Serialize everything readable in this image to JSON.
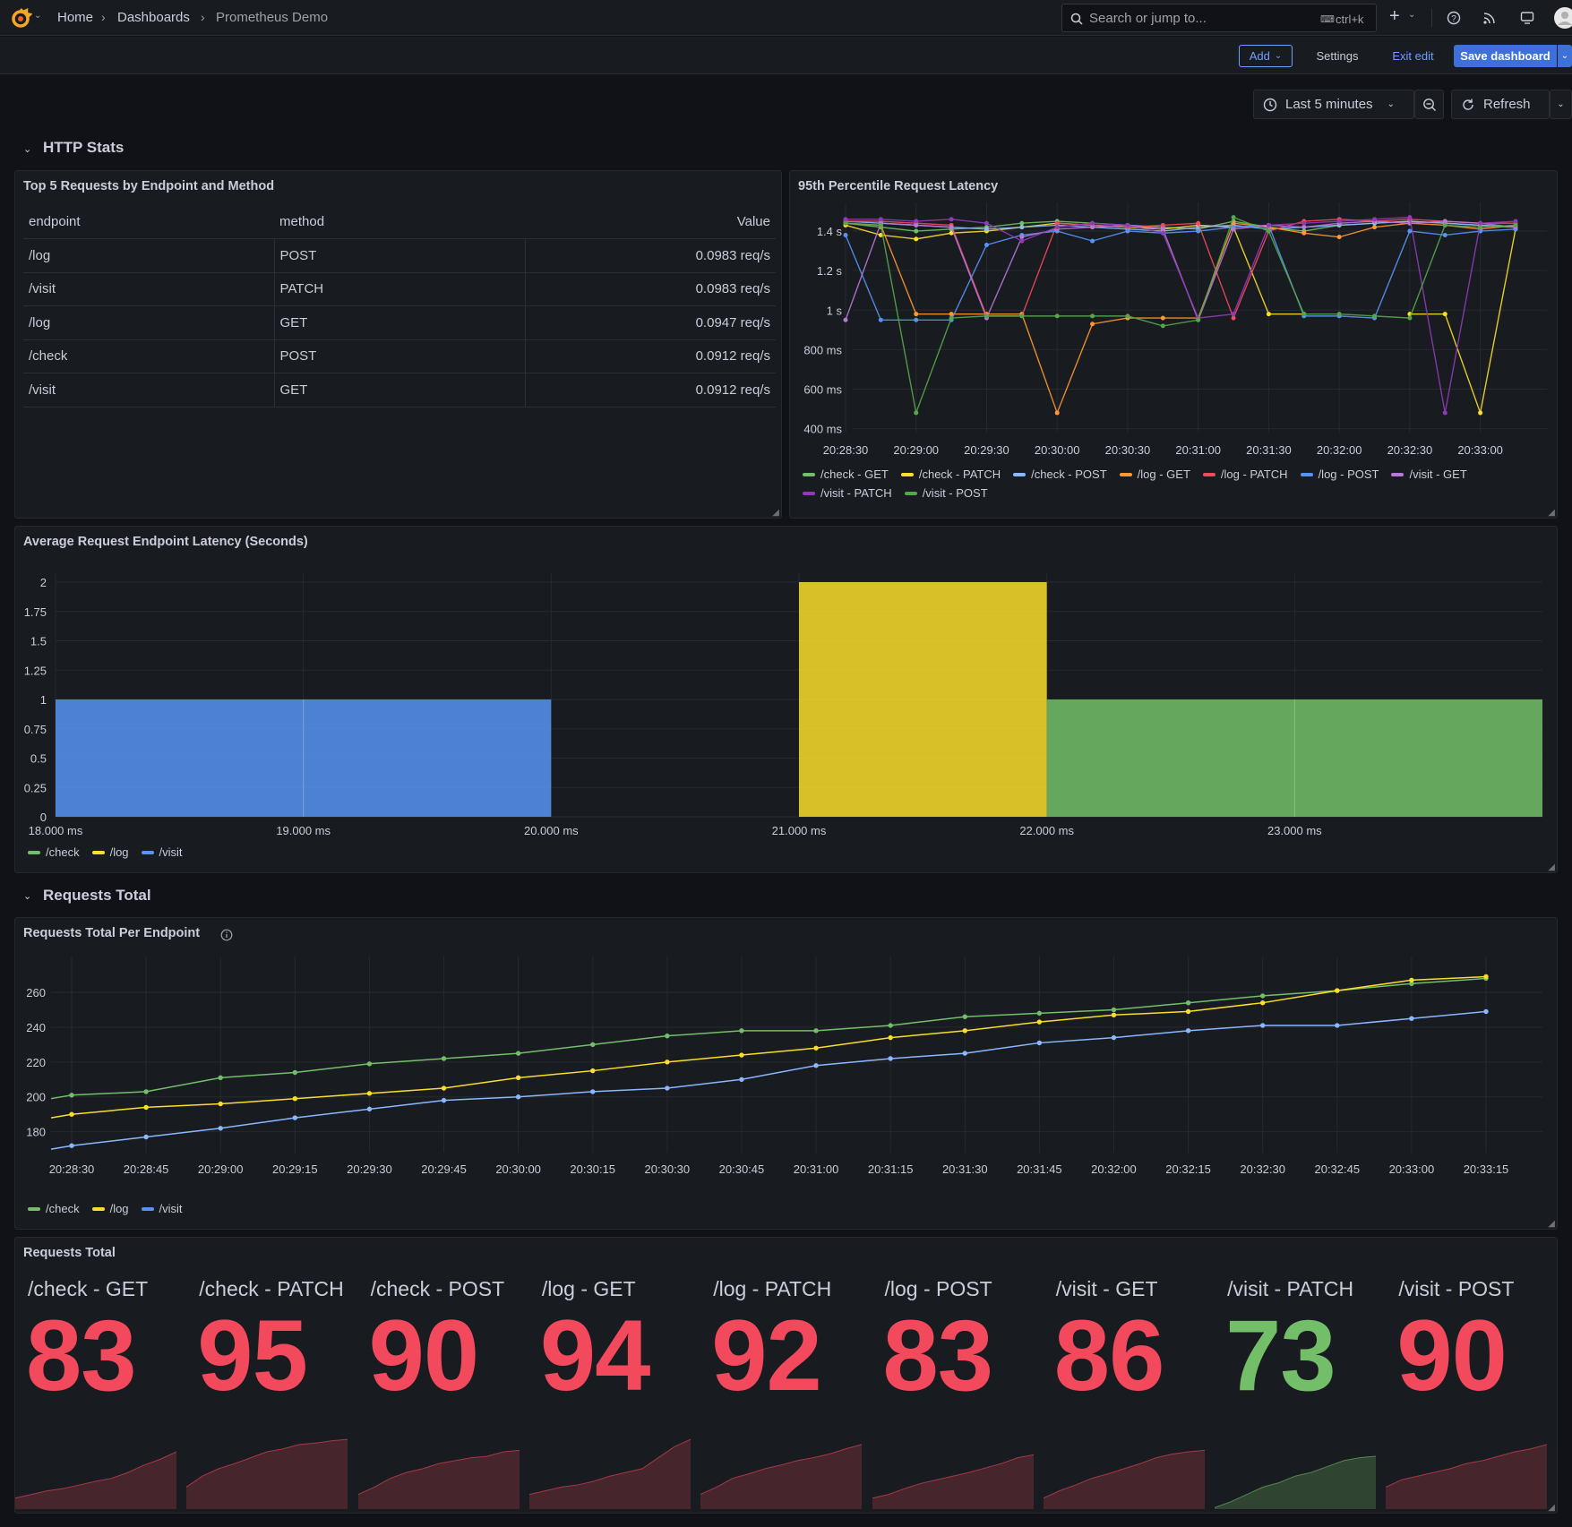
{
  "topbar": {
    "breadcrumbs": [
      "Home",
      "Dashboards",
      "Prometheus Demo"
    ],
    "search_placeholder": "Search or jump to...",
    "search_shortcut": "ctrl+k"
  },
  "toolbar": {
    "add_label": "Add",
    "settings_label": "Settings",
    "exit_edit_label": "Exit edit",
    "save_label": "Save dashboard",
    "time_range": "Last 5 minutes",
    "refresh_label": "Refresh"
  },
  "rows": {
    "http_stats": "HTTP Stats",
    "requests_total": "Requests Total"
  },
  "colors": {
    "green": "#73bf69",
    "yellow": "#fade2a",
    "blue": "#5794f2",
    "orange": "#ff9830",
    "red": "#f2495c",
    "purple": "#b877d9",
    "lightblue": "#8ab8ff",
    "darkgreen": "#56a64b",
    "violet": "#8f3bb8"
  },
  "table_panel": {
    "title": "Top 5 Requests by Endpoint and Method",
    "columns": [
      "endpoint",
      "method",
      "Value"
    ],
    "rows": [
      [
        "/log",
        "POST",
        "0.0983 req/s"
      ],
      [
        "/visit",
        "PATCH",
        "0.0983 req/s"
      ],
      [
        "/log",
        "GET",
        "0.0947 req/s"
      ],
      [
        "/check",
        "POST",
        "0.0912 req/s"
      ],
      [
        "/visit",
        "GET",
        "0.0912 req/s"
      ]
    ]
  },
  "chart_data": [
    {
      "type": "line",
      "title": "95th Percentile Request Latency",
      "y_ticks": [
        "400 ms",
        "600 ms",
        "800 ms",
        "1 s",
        "1.2 s",
        "1.4 s"
      ],
      "ylim": [
        0.38,
        1.5
      ],
      "x_ticks": [
        "20:28:30",
        "20:29:00",
        "20:29:30",
        "20:30:00",
        "20:30:30",
        "20:31:00",
        "20:31:30",
        "20:32:00",
        "20:32:30",
        "20:33:00"
      ],
      "x": [
        "20:28:30",
        "20:28:45",
        "20:29:00",
        "20:29:15",
        "20:29:30",
        "20:29:45",
        "20:30:00",
        "20:30:15",
        "20:30:30",
        "20:30:45",
        "20:31:00",
        "20:31:15",
        "20:31:30",
        "20:31:45",
        "20:32:00",
        "20:32:15",
        "20:32:30",
        "20:32:45",
        "20:33:00",
        "20:33:15"
      ],
      "series": [
        {
          "name": "/check - GET",
          "color": "#73bf69",
          "values": [
            1.44,
            1.42,
            1.4,
            1.41,
            1.42,
            1.44,
            1.45,
            1.44,
            1.43,
            1.42,
            1.41,
            1.45,
            1.42,
            1.4,
            1.43,
            1.44,
            1.45,
            1.44,
            1.43,
            1.42
          ]
        },
        {
          "name": "/check - PATCH",
          "color": "#fade2a",
          "values": [
            1.43,
            1.38,
            1.36,
            1.39,
            1.4,
            1.42,
            1.44,
            1.43,
            1.42,
            1.41,
            1.43,
            1.42,
            0.98,
            0.98,
            null,
            null,
            0.98,
            0.98,
            0.48,
            1.41
          ]
        },
        {
          "name": "/check - POST",
          "color": "#8ab8ff",
          "values": [
            1.45,
            1.44,
            1.43,
            1.42,
            1.41,
            1.42,
            1.43,
            1.42,
            1.41,
            1.4,
            1.42,
            1.43,
            1.41,
            1.42,
            1.43,
            1.44,
            1.45,
            1.44,
            1.43,
            1.42
          ]
        },
        {
          "name": "/log - GET",
          "color": "#ff9830",
          "values": [
            1.44,
            1.43,
            0.98,
            0.98,
            0.98,
            0.98,
            0.48,
            0.93,
            0.96,
            0.96,
            0.96,
            1.44,
            1.42,
            1.39,
            1.37,
            1.42,
            1.44,
            1.43,
            1.41,
            1.43
          ]
        },
        {
          "name": "/log - PATCH",
          "color": "#f2495c",
          "values": [
            1.45,
            1.45,
            1.44,
            1.43,
            0.97,
            0.97,
            1.44,
            1.43,
            1.42,
            1.43,
            1.44,
            0.96,
            1.4,
            1.45,
            1.46,
            1.45,
            1.46,
            1.45,
            1.44,
            1.44
          ]
        },
        {
          "name": "/log - POST",
          "color": "#5794f2",
          "values": [
            1.38,
            0.95,
            0.95,
            0.95,
            1.33,
            1.38,
            1.4,
            1.35,
            1.4,
            1.39,
            1.4,
            1.42,
            1.43,
            0.97,
            0.97,
            0.96,
            1.4,
            1.38,
            1.4,
            1.41
          ]
        },
        {
          "name": "/visit - GET",
          "color": "#b877d9",
          "values": [
            0.95,
            1.44,
            1.43,
            1.42,
            0.96,
            1.37,
            1.41,
            1.42,
            1.43,
            1.41,
            0.95,
            1.41,
            1.43,
            1.42,
            1.44,
            1.45,
            1.44,
            1.45,
            1.44,
            1.42
          ]
        },
        {
          "name": "/visit - PATCH",
          "color": "#8f3bb8",
          "values": [
            1.46,
            1.46,
            1.45,
            1.46,
            1.44,
            1.35,
            1.42,
            1.44,
            1.43,
            1.39,
            0.96,
            0.98,
            1.43,
            1.44,
            1.45,
            1.46,
            1.47,
            0.48,
            1.44,
            1.45
          ]
        },
        {
          "name": "/visit - POST",
          "color": "#56a64b",
          "values": [
            1.44,
            1.43,
            0.48,
            0.96,
            0.97,
            0.97,
            0.97,
            0.97,
            0.97,
            0.92,
            0.95,
            1.47,
            1.4,
            0.98,
            0.98,
            0.97,
            0.96,
            1.43,
            1.42,
            1.43
          ]
        }
      ]
    },
    {
      "type": "bar",
      "title": "Average Request Endpoint Latency (Seconds)",
      "x_ticks": [
        "18.000 ms",
        "19.000 ms",
        "20.000 ms",
        "21.000 ms",
        "22.000 ms",
        "23.000 ms"
      ],
      "y_ticks": [
        "0",
        "0.25",
        "0.5",
        "0.75",
        "1",
        "1.25",
        "1.5",
        "1.75",
        "2"
      ],
      "ylim": [
        0,
        2
      ],
      "xlim": [
        18,
        24
      ],
      "bars": [
        {
          "series": "/visit",
          "x_start": 18,
          "x_end": 20,
          "value": 1,
          "color": "#5794f2"
        },
        {
          "series": "/log",
          "x_start": 21,
          "x_end": 22,
          "value": 2,
          "color": "#fade2a"
        },
        {
          "series": "/check",
          "x_start": 22,
          "x_end": 24,
          "value": 1,
          "color": "#73bf69"
        }
      ],
      "legend": [
        {
          "name": "/check",
          "color": "#73bf69"
        },
        {
          "name": "/log",
          "color": "#fade2a"
        },
        {
          "name": "/visit",
          "color": "#5794f2"
        }
      ]
    },
    {
      "type": "line",
      "title": "Requests Total Per Endpoint",
      "y_ticks": [
        "180",
        "200",
        "220",
        "240",
        "260"
      ],
      "ylim": [
        168,
        278
      ],
      "x_ticks": [
        "20:28:30",
        "20:28:45",
        "20:29:00",
        "20:29:15",
        "20:29:30",
        "20:29:45",
        "20:30:00",
        "20:30:15",
        "20:30:30",
        "20:30:45",
        "20:31:00",
        "20:31:15",
        "20:31:30",
        "20:31:45",
        "20:32:00",
        "20:32:15",
        "20:32:30",
        "20:32:45",
        "20:33:00",
        "20:33:15"
      ],
      "series": [
        {
          "name": "/check",
          "color": "#73bf69",
          "values": [
            201,
            203,
            211,
            214,
            219,
            222,
            225,
            230,
            235,
            238,
            238,
            241,
            246,
            248,
            250,
            254,
            258,
            261,
            265,
            268
          ]
        },
        {
          "name": "/log",
          "color": "#fade2a",
          "values": [
            190,
            194,
            196,
            199,
            202,
            205,
            211,
            215,
            220,
            224,
            228,
            234,
            238,
            243,
            247,
            249,
            254,
            261,
            267,
            269
          ]
        },
        {
          "name": "/visit",
          "color": "#8ab8ff",
          "values": [
            172,
            177,
            182,
            188,
            193,
            198,
            200,
            203,
            205,
            210,
            218,
            222,
            225,
            231,
            234,
            238,
            241,
            241,
            245,
            249
          ]
        }
      ],
      "legend": [
        {
          "name": "/check",
          "color": "#73bf69"
        },
        {
          "name": "/log",
          "color": "#fade2a"
        },
        {
          "name": "/visit",
          "color": "#5794f2"
        }
      ]
    }
  ],
  "stat_panel": {
    "title": "Requests Total",
    "stats": [
      {
        "label": "/check - GET",
        "value": "83",
        "color": "#f2495c"
      },
      {
        "label": "/check - PATCH",
        "value": "95",
        "color": "#f2495c"
      },
      {
        "label": "/check - POST",
        "value": "90",
        "color": "#f2495c"
      },
      {
        "label": "/log - GET",
        "value": "94",
        "color": "#f2495c"
      },
      {
        "label": "/log - PATCH",
        "value": "92",
        "color": "#f2495c"
      },
      {
        "label": "/log - POST",
        "value": "83",
        "color": "#f2495c"
      },
      {
        "label": "/visit - GET",
        "value": "86",
        "color": "#f2495c"
      },
      {
        "label": "/visit - PATCH",
        "value": "73",
        "color": "#73bf69"
      },
      {
        "label": "/visit - POST",
        "value": "90",
        "color": "#f2495c"
      }
    ]
  }
}
